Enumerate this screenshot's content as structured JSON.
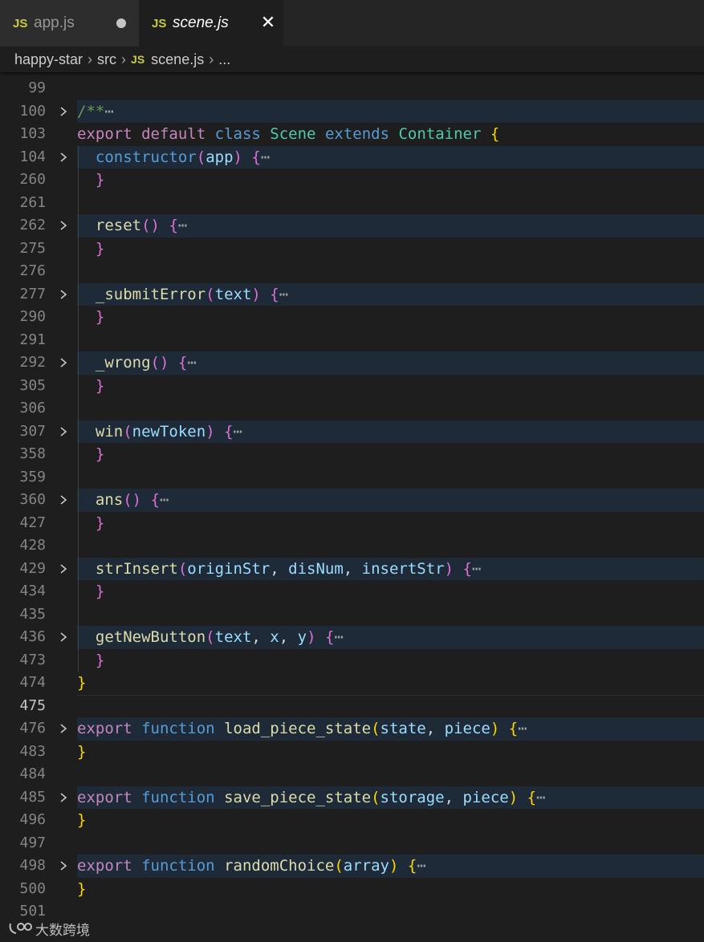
{
  "tabs": [
    {
      "badge": "JS",
      "label": "app.js",
      "state": "modified"
    },
    {
      "badge": "JS",
      "label": "scene.js",
      "state": "active",
      "close": "✕"
    }
  ],
  "breadcrumb": {
    "items": [
      "happy-star",
      "src"
    ],
    "file_badge": "JS",
    "file": "scene.js",
    "more": "..."
  },
  "editor": {
    "lines": [
      {
        "n": "99",
        "fold": false,
        "hl": false,
        "tokens": []
      },
      {
        "n": "100",
        "fold": true,
        "hl": true,
        "tokens": [
          [
            "cm",
            "/**"
          ],
          [
            "ell",
            "⋯"
          ]
        ]
      },
      {
        "n": "103",
        "fold": false,
        "hl": false,
        "tokens": [
          [
            "kw",
            "export"
          ],
          [
            "pl",
            " "
          ],
          [
            "kw",
            "default"
          ],
          [
            "pl",
            " "
          ],
          [
            "st",
            "class"
          ],
          [
            "pl",
            " "
          ],
          [
            "cls",
            "Scene"
          ],
          [
            "pl",
            " "
          ],
          [
            "st",
            "extends"
          ],
          [
            "pl",
            " "
          ],
          [
            "cls",
            "Container"
          ],
          [
            "pl",
            " "
          ],
          [
            "b1",
            "{"
          ]
        ]
      },
      {
        "n": "104",
        "fold": true,
        "hl": true,
        "tokens": [
          [
            "pl",
            "  "
          ],
          [
            "st",
            "constructor"
          ],
          [
            "b2",
            "("
          ],
          [
            "par",
            "app"
          ],
          [
            "b2",
            ")"
          ],
          [
            "pl",
            " "
          ],
          [
            "b2",
            "{"
          ],
          [
            "ell",
            "⋯"
          ]
        ]
      },
      {
        "n": "260",
        "fold": false,
        "hl": false,
        "tokens": [
          [
            "pl",
            "  "
          ],
          [
            "b2",
            "}"
          ]
        ]
      },
      {
        "n": "261",
        "fold": false,
        "hl": false,
        "tokens": []
      },
      {
        "n": "262",
        "fold": true,
        "hl": true,
        "tokens": [
          [
            "pl",
            "  "
          ],
          [
            "fn",
            "reset"
          ],
          [
            "b2",
            "()"
          ],
          [
            "pl",
            " "
          ],
          [
            "b2",
            "{"
          ],
          [
            "ell",
            "⋯"
          ]
        ]
      },
      {
        "n": "275",
        "fold": false,
        "hl": false,
        "tokens": [
          [
            "pl",
            "  "
          ],
          [
            "b2",
            "}"
          ]
        ]
      },
      {
        "n": "276",
        "fold": false,
        "hl": false,
        "tokens": []
      },
      {
        "n": "277",
        "fold": true,
        "hl": true,
        "tokens": [
          [
            "pl",
            "  "
          ],
          [
            "fn",
            "_submitError"
          ],
          [
            "b2",
            "("
          ],
          [
            "par",
            "text"
          ],
          [
            "b2",
            ")"
          ],
          [
            "pl",
            " "
          ],
          [
            "b2",
            "{"
          ],
          [
            "ell",
            "⋯"
          ]
        ]
      },
      {
        "n": "290",
        "fold": false,
        "hl": false,
        "tokens": [
          [
            "pl",
            "  "
          ],
          [
            "b2",
            "}"
          ]
        ]
      },
      {
        "n": "291",
        "fold": false,
        "hl": false,
        "tokens": []
      },
      {
        "n": "292",
        "fold": true,
        "hl": true,
        "tokens": [
          [
            "pl",
            "  "
          ],
          [
            "fn",
            "_wrong"
          ],
          [
            "b2",
            "()"
          ],
          [
            "pl",
            " "
          ],
          [
            "b2",
            "{"
          ],
          [
            "ell",
            "⋯"
          ]
        ]
      },
      {
        "n": "305",
        "fold": false,
        "hl": false,
        "tokens": [
          [
            "pl",
            "  "
          ],
          [
            "b2",
            "}"
          ]
        ]
      },
      {
        "n": "306",
        "fold": false,
        "hl": false,
        "tokens": []
      },
      {
        "n": "307",
        "fold": true,
        "hl": true,
        "tokens": [
          [
            "pl",
            "  "
          ],
          [
            "fn",
            "win"
          ],
          [
            "b2",
            "("
          ],
          [
            "par",
            "newToken"
          ],
          [
            "b2",
            ")"
          ],
          [
            "pl",
            " "
          ],
          [
            "b2",
            "{"
          ],
          [
            "ell",
            "⋯"
          ]
        ]
      },
      {
        "n": "358",
        "fold": false,
        "hl": false,
        "tokens": [
          [
            "pl",
            "  "
          ],
          [
            "b2",
            "}"
          ]
        ]
      },
      {
        "n": "359",
        "fold": false,
        "hl": false,
        "tokens": []
      },
      {
        "n": "360",
        "fold": true,
        "hl": true,
        "tokens": [
          [
            "pl",
            "  "
          ],
          [
            "fn",
            "ans"
          ],
          [
            "b2",
            "()"
          ],
          [
            "pl",
            " "
          ],
          [
            "b2",
            "{"
          ],
          [
            "ell",
            "⋯"
          ]
        ]
      },
      {
        "n": "427",
        "fold": false,
        "hl": false,
        "tokens": [
          [
            "pl",
            "  "
          ],
          [
            "b2",
            "}"
          ]
        ]
      },
      {
        "n": "428",
        "fold": false,
        "hl": false,
        "tokens": []
      },
      {
        "n": "429",
        "fold": true,
        "hl": true,
        "tokens": [
          [
            "pl",
            "  "
          ],
          [
            "fn",
            "strInsert"
          ],
          [
            "b2",
            "("
          ],
          [
            "par",
            "originStr"
          ],
          [
            "pl",
            ", "
          ],
          [
            "par",
            "disNum"
          ],
          [
            "pl",
            ", "
          ],
          [
            "par",
            "insertStr"
          ],
          [
            "b2",
            ")"
          ],
          [
            "pl",
            " "
          ],
          [
            "b2",
            "{"
          ],
          [
            "ell",
            "⋯"
          ]
        ]
      },
      {
        "n": "434",
        "fold": false,
        "hl": false,
        "tokens": [
          [
            "pl",
            "  "
          ],
          [
            "b2",
            "}"
          ]
        ]
      },
      {
        "n": "435",
        "fold": false,
        "hl": false,
        "tokens": []
      },
      {
        "n": "436",
        "fold": true,
        "hl": true,
        "tokens": [
          [
            "pl",
            "  "
          ],
          [
            "fn",
            "getNewButton"
          ],
          [
            "b2",
            "("
          ],
          [
            "par",
            "text"
          ],
          [
            "pl",
            ", "
          ],
          [
            "par",
            "x"
          ],
          [
            "pl",
            ", "
          ],
          [
            "par",
            "y"
          ],
          [
            "b2",
            ")"
          ],
          [
            "pl",
            " "
          ],
          [
            "b2",
            "{"
          ],
          [
            "ell",
            "⋯"
          ]
        ]
      },
      {
        "n": "473",
        "fold": false,
        "hl": false,
        "tokens": [
          [
            "pl",
            "  "
          ],
          [
            "b2",
            "}"
          ]
        ]
      },
      {
        "n": "474",
        "fold": false,
        "hl": false,
        "tokens": [
          [
            "b1",
            "}"
          ]
        ]
      },
      {
        "n": "475",
        "fold": false,
        "hl": false,
        "cur": true,
        "tokens": []
      },
      {
        "n": "476",
        "fold": true,
        "hl": true,
        "tokens": [
          [
            "kw",
            "export"
          ],
          [
            "pl",
            " "
          ],
          [
            "st",
            "function"
          ],
          [
            "pl",
            " "
          ],
          [
            "fn",
            "load_piece_state"
          ],
          [
            "b1",
            "("
          ],
          [
            "par",
            "state"
          ],
          [
            "pl",
            ", "
          ],
          [
            "par",
            "piece"
          ],
          [
            "b1",
            ")"
          ],
          [
            "pl",
            " "
          ],
          [
            "b1",
            "{"
          ],
          [
            "ell",
            "⋯"
          ]
        ]
      },
      {
        "n": "483",
        "fold": false,
        "hl": false,
        "tokens": [
          [
            "b1",
            "}"
          ]
        ]
      },
      {
        "n": "484",
        "fold": false,
        "hl": false,
        "tokens": []
      },
      {
        "n": "485",
        "fold": true,
        "hl": true,
        "tokens": [
          [
            "kw",
            "export"
          ],
          [
            "pl",
            " "
          ],
          [
            "st",
            "function"
          ],
          [
            "pl",
            " "
          ],
          [
            "fn",
            "save_piece_state"
          ],
          [
            "b1",
            "("
          ],
          [
            "par",
            "storage"
          ],
          [
            "pl",
            ", "
          ],
          [
            "par",
            "piece"
          ],
          [
            "b1",
            ")"
          ],
          [
            "pl",
            " "
          ],
          [
            "b1",
            "{"
          ],
          [
            "ell",
            "⋯"
          ]
        ]
      },
      {
        "n": "496",
        "fold": false,
        "hl": false,
        "tokens": [
          [
            "b1",
            "}"
          ]
        ]
      },
      {
        "n": "497",
        "fold": false,
        "hl": false,
        "tokens": []
      },
      {
        "n": "498",
        "fold": true,
        "hl": true,
        "tokens": [
          [
            "kw",
            "export"
          ],
          [
            "pl",
            " "
          ],
          [
            "st",
            "function"
          ],
          [
            "pl",
            " "
          ],
          [
            "fn",
            "randomChoice"
          ],
          [
            "b1",
            "("
          ],
          [
            "par",
            "array"
          ],
          [
            "b1",
            ")"
          ],
          [
            "pl",
            " "
          ],
          [
            "b1",
            "{"
          ],
          [
            "ell",
            "⋯"
          ]
        ]
      },
      {
        "n": "500",
        "fold": false,
        "hl": false,
        "tokens": [
          [
            "b1",
            "}"
          ]
        ]
      },
      {
        "n": "501",
        "fold": false,
        "hl": false,
        "tokens": []
      }
    ]
  },
  "watermark": {
    "text": "大数跨境"
  },
  "colors": {
    "background": "#1e1e1e",
    "tab_inactive": "#2d2d2d",
    "js_badge": "#cbcb41",
    "fold_highlight": "#1f2a38",
    "keyword": "#c586c0",
    "storage": "#569cd6",
    "class": "#4ec9b0",
    "function": "#dcdcaa",
    "parameter": "#9cdcfe",
    "comment": "#6a9955",
    "bracket_1": "#ffd700",
    "bracket_2": "#da70d6"
  }
}
